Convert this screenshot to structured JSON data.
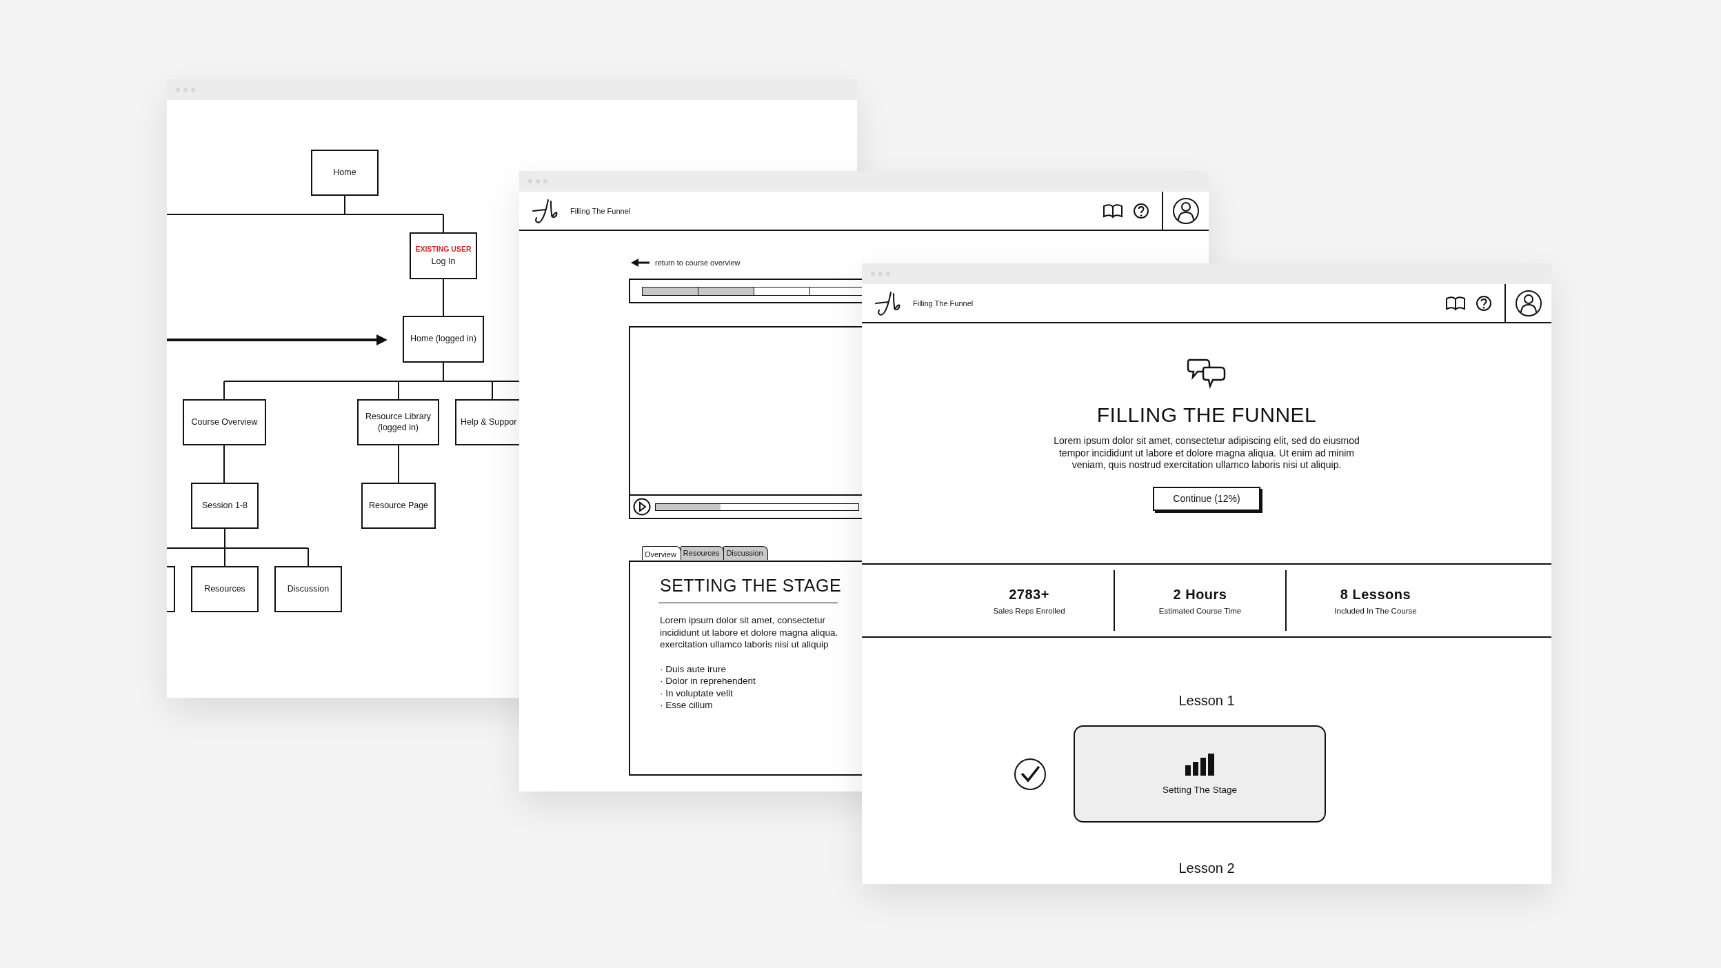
{
  "sitemap_window": {
    "nodes": [
      {
        "label": "Home"
      },
      {
        "label": "Log In",
        "tag": "EXISTING USER"
      },
      {
        "label": "Home (logged in)"
      },
      {
        "label": "Course Overview"
      },
      {
        "label": "Resource Library (logged in)"
      },
      {
        "label": "Help & Suppor"
      },
      {
        "label": "Session 1-8"
      },
      {
        "label": "Resource Page"
      },
      {
        "label": "Resources"
      },
      {
        "label": "Discussion"
      }
    ]
  },
  "lesson_window": {
    "app_title": "Filling The Funnel",
    "back_link": "return to course overview",
    "progress_segments": [
      {
        "completed": true
      },
      {
        "completed": true
      },
      {
        "completed": false
      },
      {
        "completed": false
      }
    ],
    "video": {
      "level": 0.32
    },
    "tabs": [
      {
        "label": "Overview",
        "selected": true
      },
      {
        "label": "Resources",
        "selected": false
      },
      {
        "label": "Discussion",
        "selected": false
      }
    ],
    "heading": "SETTING THE STAGE",
    "paragraph": "Lorem ipsum dolor sit amet, consectetur\nincididunt ut labore et dolore magna aliqua.\nexercitation ullamco laboris nisi ut aliquip",
    "bullets": [
      "· Duis aute irure",
      "· Dolor in reprehenderit",
      "· In voluptate velit",
      "· Esse cillum"
    ]
  },
  "course_window": {
    "app_title": "Filling The Funnel",
    "heading": "FILLING THE FUNNEL",
    "description": "Lorem ipsum dolor sit amet, consectetur adipiscing elit, sed do eiusmod\ntempor incididunt ut labore et dolore magna aliqua. Ut enim ad minim\nveniam, quis nostrud exercitation ullamco laboris nisi ut aliquip.",
    "continue_button": "Continue (12%)",
    "stats": [
      {
        "value": "2783+",
        "label": "Sales Reps Enrolled"
      },
      {
        "value": "2 Hours",
        "label": "Estimated Course Time"
      },
      {
        "value": "8 Lessons",
        "label": "Included In The Course"
      }
    ],
    "lessons": [
      {
        "title": "Lesson 1",
        "name": "Setting The Stage",
        "completed": true
      }
    ],
    "next_lesson_title": "Lesson 2"
  }
}
